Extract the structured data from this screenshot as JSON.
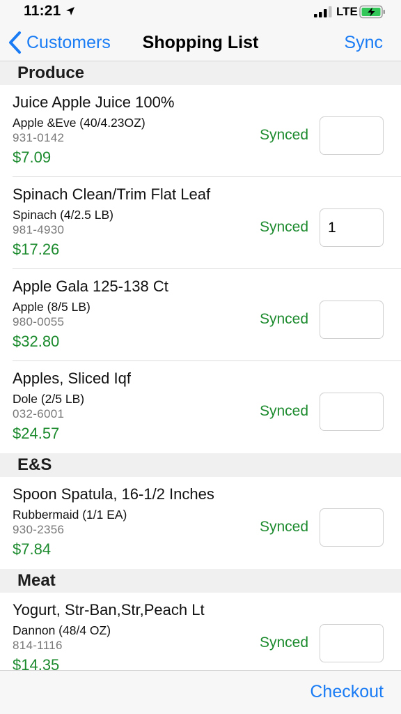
{
  "status_bar": {
    "time": "11:21",
    "network": "LTE"
  },
  "nav": {
    "back_label": "Customers",
    "title": "Shopping List",
    "action_label": "Sync"
  },
  "sections": [
    {
      "title": "Produce",
      "items": [
        {
          "name": "Juice Apple Juice 100%",
          "brand": "Apple &Eve (40/4.23OZ)",
          "sku": "931-0142",
          "price": "$7.09",
          "status": "Synced",
          "quantity": ""
        },
        {
          "name": "Spinach Clean/Trim Flat Leaf",
          "brand": "Spinach (4/2.5 LB)",
          "sku": "981-4930",
          "price": "$17.26",
          "status": "Synced",
          "quantity": "1"
        },
        {
          "name": "Apple Gala 125-138 Ct",
          "brand": "Apple (8/5 LB)",
          "sku": "980-0055",
          "price": "$32.80",
          "status": "Synced",
          "quantity": ""
        },
        {
          "name": "Apples, Sliced Iqf",
          "brand": "Dole (2/5 LB)",
          "sku": "032-6001",
          "price": "$24.57",
          "status": "Synced",
          "quantity": ""
        }
      ]
    },
    {
      "title": "E&S",
      "items": [
        {
          "name": "Spoon Spatula, 16-1/2 Inches",
          "brand": "Rubbermaid (1/1 EA)",
          "sku": "930-2356",
          "price": "$7.84",
          "status": "Synced",
          "quantity": ""
        }
      ]
    },
    {
      "title": "Meat",
      "items": [
        {
          "name": "Yogurt, Str-Ban,Str,Peach Lt",
          "brand": "Dannon (48/4 OZ)",
          "sku": "814-1116",
          "price": "$14.35",
          "status": "Synced",
          "quantity": ""
        }
      ]
    }
  ],
  "toolbar": {
    "checkout_label": "Checkout"
  },
  "colors": {
    "accent": "#1a7cf5",
    "synced": "#1b8a2d",
    "price": "#1b8a2d",
    "battery": "#33c759"
  }
}
